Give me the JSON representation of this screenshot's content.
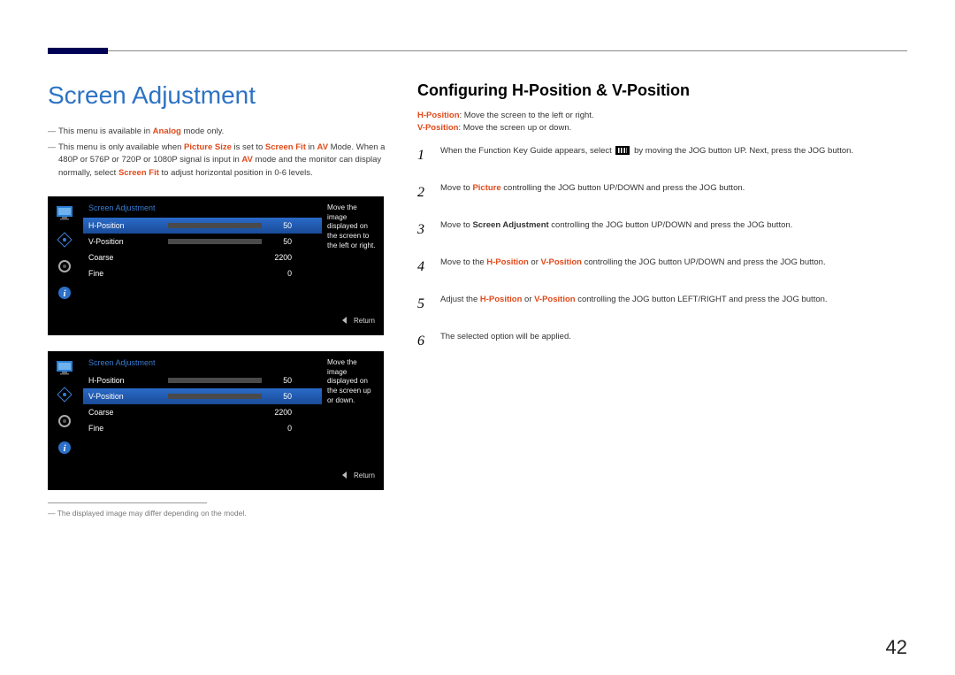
{
  "header": {
    "page_title": "Screen Adjustment",
    "section_title": "Configuring H-Position & V-Position"
  },
  "left_notes": {
    "n1_pre": "This menu is available in ",
    "n1_analog": "Analog",
    "n1_post": " mode only.",
    "n2_pre": "This menu is only available when ",
    "n2_ps": "Picture Size",
    "n2_mid1": " is set to ",
    "n2_sf": "Screen Fit",
    "n2_mid2": " in ",
    "n2_av": "AV",
    "n2_mid3": " Mode. When a 480P or 576P or 720P or 1080P signal is input in ",
    "n2_av2": "AV",
    "n2_mid4": " mode and the monitor can display normally, select ",
    "n2_sf2": "Screen Fit",
    "n2_post": " to adjust horizontal position in 0-6 levels."
  },
  "osd1": {
    "title": "Screen Adjustment",
    "rows": [
      {
        "label": "H-Position",
        "value": "50",
        "fill": 50,
        "selected": true
      },
      {
        "label": "V-Position",
        "value": "50",
        "fill": 50,
        "selected": false
      },
      {
        "label": "Coarse",
        "value": "2200",
        "fill": 0,
        "selected": false,
        "nobar": true
      },
      {
        "label": "Fine",
        "value": "0",
        "fill": 0,
        "selected": false,
        "nobar": true
      }
    ],
    "tip": "Move the image displayed on the screen to the left or right.",
    "return": "Return"
  },
  "osd2": {
    "title": "Screen Adjustment",
    "rows": [
      {
        "label": "H-Position",
        "value": "50",
        "fill": 50,
        "selected": false
      },
      {
        "label": "V-Position",
        "value": "50",
        "fill": 50,
        "selected": true
      },
      {
        "label": "Coarse",
        "value": "2200",
        "fill": 0,
        "selected": false,
        "nobar": true
      },
      {
        "label": "Fine",
        "value": "0",
        "fill": 0,
        "selected": false,
        "nobar": true
      }
    ],
    "tip": "Move the image displayed on the screen up or down.",
    "return": "Return"
  },
  "footnote": "― The displayed image may differ depending on the model.",
  "right": {
    "d1_pre": "H-Position",
    "d1_post": ": Move the screen to the left or right.",
    "d2_pre": "V-Position",
    "d2_post": ": Move the screen up or down.",
    "s1a": "When the Function Key Guide appears, select ",
    "s1b": " by moving the JOG button UP. Next, press the JOG button.",
    "s2a": "Move to ",
    "s2_picture": "Picture",
    "s2b": " controlling the JOG button UP/DOWN and press the JOG button.",
    "s3a": "Move to ",
    "s3_sa": "Screen Adjustment",
    "s3b": " controlling the JOG button UP/DOWN and press the JOG button.",
    "s4a": "Move to the ",
    "s4_h": "H-Position",
    "s4_or": " or ",
    "s4_v": "V-Position",
    "s4b": " controlling the JOG button UP/DOWN and press the JOG button.",
    "s5a": "Adjust the ",
    "s5_h": "H-Position",
    "s5_or": " or ",
    "s5_v": "V-Position",
    "s5b": " controlling the JOG button LEFT/RIGHT and press the JOG button.",
    "s6": "The selected option will be applied.",
    "nums": [
      "1",
      "2",
      "3",
      "4",
      "5",
      "6"
    ]
  },
  "page_number": "42"
}
